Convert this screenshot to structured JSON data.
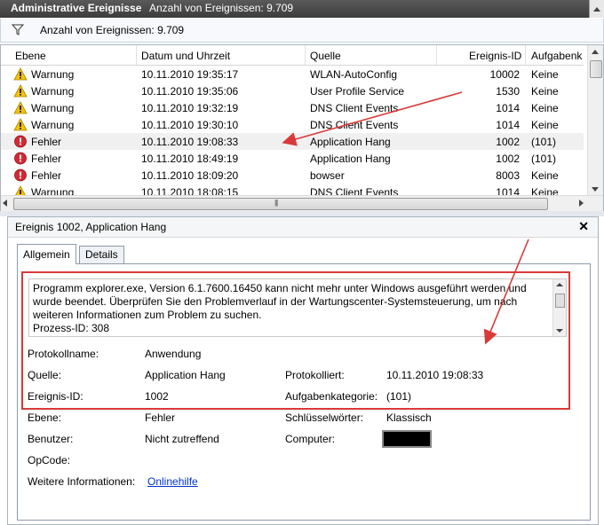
{
  "window": {
    "title": "Administrative Ereignisse",
    "count_label": "Anzahl von Ereignissen: 9.709"
  },
  "filter": {
    "label": "Anzahl von Ereignissen: 9.709"
  },
  "columns": [
    "Ebene",
    "Datum und Uhrzeit",
    "Quelle",
    "Ereignis-ID",
    "Aufgabenk"
  ],
  "rows": [
    {
      "level": "Warnung",
      "icon": "warning-icon",
      "date": "10.11.2010 19:35:17",
      "source": "WLAN-AutoConfig",
      "id": "10002",
      "task": "Keine"
    },
    {
      "level": "Warnung",
      "icon": "warning-icon",
      "date": "10.11.2010 19:35:06",
      "source": "User Profile Service",
      "id": "1530",
      "task": "Keine"
    },
    {
      "level": "Warnung",
      "icon": "warning-icon",
      "date": "10.11.2010 19:32:19",
      "source": "DNS Client Events",
      "id": "1014",
      "task": "Keine"
    },
    {
      "level": "Warnung",
      "icon": "warning-icon",
      "date": "10.11.2010 19:30:10",
      "source": "DNS Client Events",
      "id": "1014",
      "task": "Keine"
    },
    {
      "level": "Fehler",
      "icon": "error-icon",
      "date": "10.11.2010 19:08:33",
      "source": "Application Hang",
      "id": "1002",
      "task": "(101)"
    },
    {
      "level": "Fehler",
      "icon": "error-icon",
      "date": "10.11.2010 18:49:19",
      "source": "Application Hang",
      "id": "1002",
      "task": "(101)"
    },
    {
      "level": "Fehler",
      "icon": "error-icon",
      "date": "10.11.2010 18:09:20",
      "source": "bowser",
      "id": "8003",
      "task": "Keine"
    },
    {
      "level": "Warnung",
      "icon": "warning-icon",
      "date": "10.11.2010 18:08:15",
      "source": "DNS Client Events",
      "id": "1014",
      "task": "Keine"
    }
  ],
  "detail": {
    "title": "Ereignis 1002, Application Hang",
    "close": "✕",
    "tabs": [
      "Allgemein",
      "Details"
    ],
    "message": "Programm explorer.exe, Version 6.1.7600.16450 kann nicht mehr unter Windows ausgeführt werden und wurde beendet. Überprüfen Sie den Problemverlauf in der Wartungscenter-Systemsteuerung, um nach weiteren Informationen zum Problem zu suchen.",
    "message_extra": "Prozess-ID: 308",
    "fields": {
      "protokollname_label": "Protokollname:",
      "protokollname_value": "Anwendung",
      "quelle_label": "Quelle:",
      "quelle_value": "Application Hang",
      "protokolliert_label": "Protokolliert:",
      "protokolliert_value": "10.11.2010 19:08:33",
      "ereignisid_label": "Ereignis-ID:",
      "ereignisid_value": "1002",
      "aufgabenkategorie_label": "Aufgabenkategorie:",
      "aufgabenkategorie_value": "(101)",
      "ebene_label": "Ebene:",
      "ebene_value": "Fehler",
      "schluesselwoerter_label": "Schlüsselwörter:",
      "schluesselwoerter_value": "Klassisch",
      "benutzer_label": "Benutzer:",
      "benutzer_value": "Nicht zutreffend",
      "computer_label": "Computer:",
      "opcode_label": "OpCode:",
      "weitere_label": "Weitere Informationen:",
      "weitere_link": "Onlinehilfe"
    }
  },
  "colors": {
    "annotation": "#d83a3a",
    "link": "#0033cc",
    "warning": "#f2c200",
    "error": "#c8202c"
  }
}
